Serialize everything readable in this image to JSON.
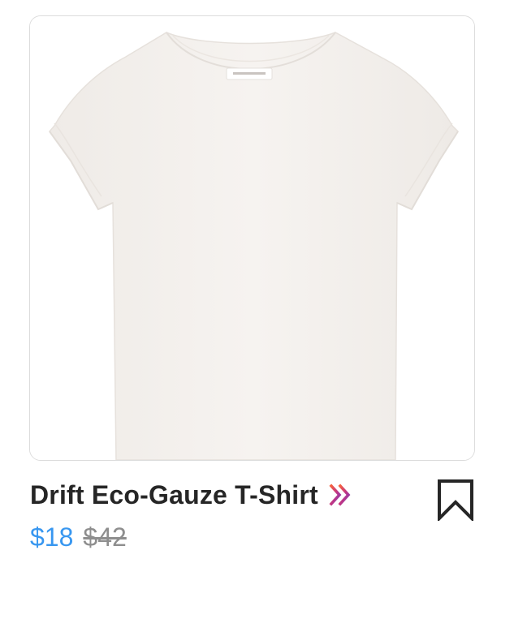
{
  "product": {
    "title": "Drift Eco-Gauze T-Shirt",
    "sale_price": "$18",
    "original_price": "$42",
    "image_icon": "tshirt-photo",
    "link_icon": "double-chevron-right-icon",
    "save_icon": "bookmark-icon"
  },
  "colors": {
    "title": "#262626",
    "sale_price": "#3897f0",
    "original_price": "#8e8e8e",
    "shirt": "#f5f2ef",
    "chevron_gradient": [
      "#f56040",
      "#c13584",
      "#833ab4"
    ]
  }
}
